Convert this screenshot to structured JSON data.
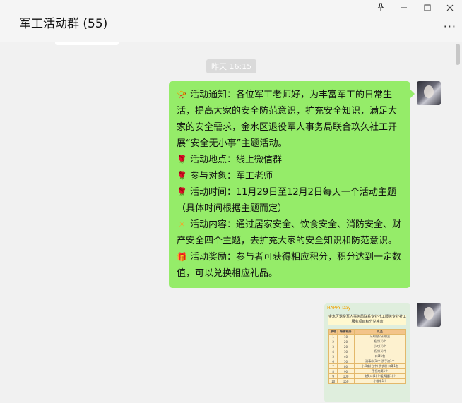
{
  "window": {
    "title": "军工活动群 (55)",
    "pin_icon": "pin-icon",
    "minimize_icon": "minimize-icon",
    "maximize_icon": "maximize-icon",
    "close_icon": "close-icon",
    "more_label": "···"
  },
  "chat": {
    "timestamp": "昨天 16:15",
    "message": {
      "paragraphs": [
        {
          "icon": "trumpet-emoji",
          "glyph": "📯",
          "text": "活动通知：各位军工老师好，为丰富军工的日常生活，提高大家的安全防范意识，扩充安全知识，满足大家的安全需求，金水区退役军人事务局联合玖久社工开展“安全无小事”主题活动。"
        },
        {
          "icon": "rose-emoji",
          "glyph": "🌹",
          "text": "活动地点：线上微信群"
        },
        {
          "icon": "rose-emoji",
          "glyph": "🌹",
          "text": "参与对象：军工老师"
        },
        {
          "icon": "rose-emoji",
          "glyph": "🌹",
          "text": "活动时间：11月29日至12月2日每天一个活动主题（具体时间根据主题而定）"
        },
        {
          "icon": "sun-emoji",
          "glyph": "☀",
          "text": "活动内容：通过居家安全、饮食安全、消防安全、财产安全四个主题，去扩充大家的安全知识和防范意识。"
        },
        {
          "icon": "gift-emoji",
          "glyph": "🎁",
          "text": "活动奖励：参与者可获得相应积分，积分达到一定数值，可以兑换相应礼品。"
        }
      ]
    },
    "image_message": {
      "banner": "HAPPY Day",
      "heading": "金水区退役军人事务局联系专业社工服务专业社工服务项目积分兑换表",
      "table_header": [
        "序号",
        "所需积分",
        "礼品"
      ],
      "rows": [
        [
          "1",
          "10",
          "牙刷(支/牙刷)支"
        ],
        [
          "2",
          "20",
          "毛巾(1)个"
        ],
        [
          "3",
          "20",
          "小刀(1)个"
        ],
        [
          "4",
          "30",
          "纸巾(1)件"
        ],
        [
          "5",
          "40",
          "口罩1包"
        ],
        [
          "6",
          "50",
          "消毒水(1)个·洗手液1个"
        ],
        [
          "7",
          "80",
          "小风扇(台中)·洗衣粉·口罩1包"
        ],
        [
          "8",
          "90",
          "手摇电筒1个"
        ],
        [
          "9",
          "100",
          "电熨斗(1)个·暖风器(1)个"
        ],
        [
          "10",
          "150",
          "小推车1个"
        ]
      ]
    }
  }
}
